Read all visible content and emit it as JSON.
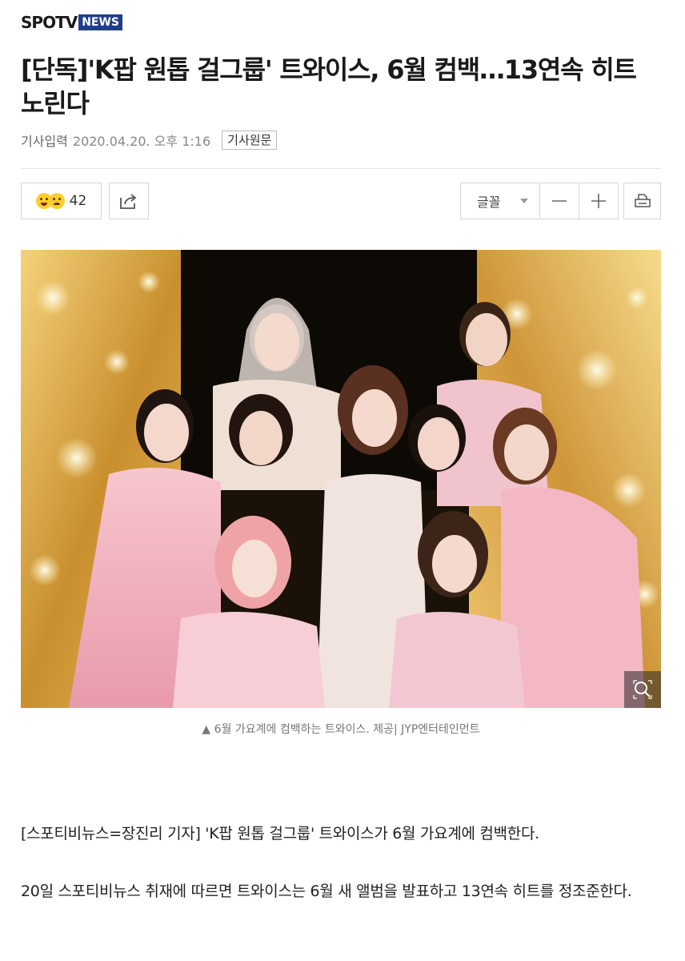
{
  "logo": {
    "part1": "SPOTV",
    "part2": "NEWS"
  },
  "headline": "[단독]'K팝 원톱 걸그룹' 트와이스, 6월 컴백…13연속 히트 노린다",
  "meta": {
    "label": "기사입력",
    "datetime": "2020.04.20. 오후 1:16",
    "original_button": "기사원문"
  },
  "toolbar": {
    "reaction_count": "42",
    "font_label": "글꼴",
    "minus": "—",
    "plus": "+"
  },
  "photo": {
    "caption": "▲ 6월 가요계에 컴백하는 트와이스. 제공| JYP엔터테인먼트"
  },
  "body": {
    "p1": "[스포티비뉴스=장진리 기자] 'K팝 원톱 걸그룹' 트와이스가 6월 가요계에 컴백한다.",
    "p2": "20일 스포티비뉴스 취재에 따르면 트와이스는 6월 새 앨범을 발표하고 13연속 히트를 정조준한다."
  },
  "colors": {
    "brand_blue": "#1f3f8a",
    "gold": "#d9a640",
    "pink": "#f2a9b8"
  }
}
